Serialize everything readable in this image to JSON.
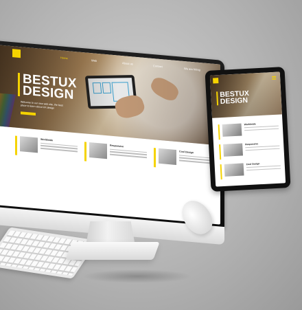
{
  "desktop": {
    "hero_title_line1": "BESTUX",
    "hero_title_line2": "DESIGN",
    "hero_subtitle": "Welcome to our new web site, the best place to learn about UX design",
    "nav": [
      "Home",
      "Web",
      "About us",
      "Contact",
      "We are hiring"
    ],
    "cards": [
      {
        "title": "Worldwide"
      },
      {
        "title": "Responsive"
      },
      {
        "title": "Cool Design"
      }
    ]
  },
  "tablet": {
    "hero_title_line1": "BESTUX",
    "hero_title_line2": "DESIGN",
    "items": [
      {
        "title": "Worldwide"
      },
      {
        "title": "Responsive"
      },
      {
        "title": "Cool Design"
      }
    ]
  },
  "colors": {
    "accent": "#f5d300",
    "background": "#b4b4b4"
  }
}
